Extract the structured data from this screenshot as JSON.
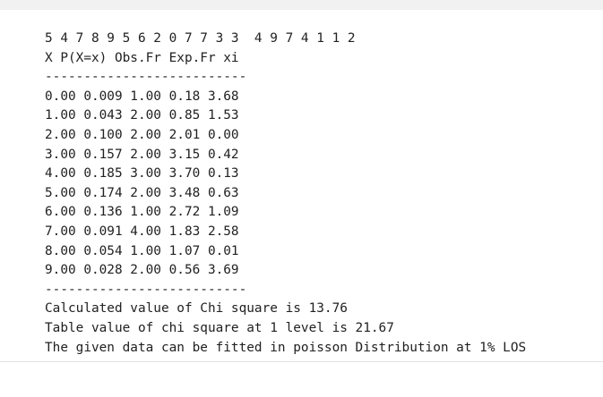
{
  "output": {
    "lines": [
      "5 4 7 8 9 5 6 2 0 7 7 3 3  4 9 7 4 1 1 2",
      "X P(X=x) Obs.Fr Exp.Fr xi",
      "--------------------------",
      "0.00 0.009 1.00 0.18 3.68",
      "1.00 0.043 2.00 0.85 1.53",
      "2.00 0.100 2.00 2.01 0.00",
      "3.00 0.157 2.00 3.15 0.42",
      "4.00 0.185 3.00 3.70 0.13",
      "5.00 0.174 2.00 3.48 0.63",
      "6.00 0.136 1.00 2.72 1.09",
      "7.00 0.091 4.00 1.83 2.58",
      "8.00 0.054 1.00 1.07 0.01",
      "9.00 0.028 2.00 0.56 3.69",
      "--------------------------",
      "Calculated value of Chi square is 13.76",
      "Table value of chi square at 1 level is 21.67",
      "The given data can be fitted in poisson Distribution at 1% LOS"
    ]
  }
}
